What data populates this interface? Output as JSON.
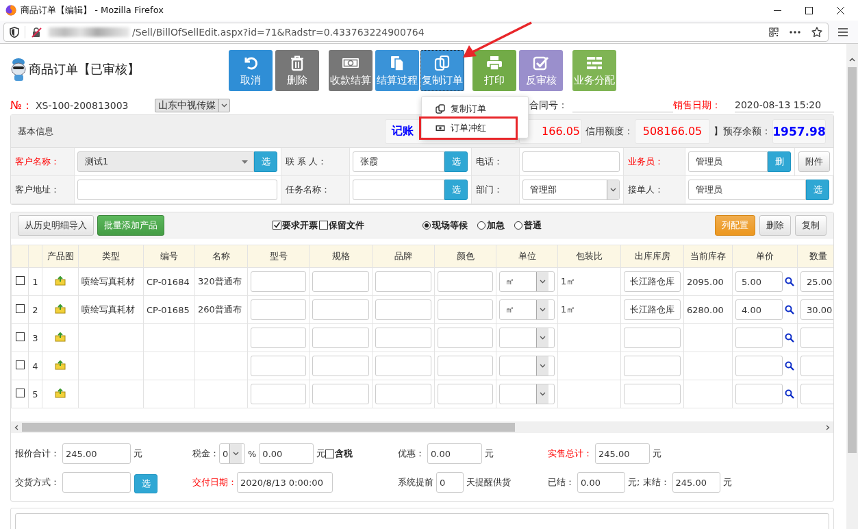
{
  "window": {
    "title": "商品订单【编辑】 - Mozilla Firefox"
  },
  "address_bar": {
    "url": "/Sell/BillOfSellEdit.aspx?id=71&Radstr=0.433763224900764"
  },
  "page": {
    "title": "商品订单【已审核】"
  },
  "toolbar": [
    {
      "label": "取消",
      "kind": "undo",
      "color": "#2f8ed6",
      "focused": false
    },
    {
      "label": "删除",
      "kind": "trash",
      "color": "#777777",
      "focused": false
    },
    {
      "label": "收款结算",
      "kind": "money",
      "color": "#777777",
      "focused": false
    },
    {
      "label": "结算过程",
      "kind": "document",
      "color": "#3a93d8",
      "focused": false
    },
    {
      "label": "复制订单",
      "kind": "copy",
      "color": "#3a93d8",
      "focused": true
    },
    {
      "label": "打印",
      "kind": "print",
      "color": "#72ab47",
      "focused": false
    },
    {
      "label": "反审核",
      "kind": "check",
      "color": "#9a8fcc",
      "focused": false
    },
    {
      "label": "业务分配",
      "kind": "bars",
      "color": "#7fb454",
      "focused": false
    }
  ],
  "order": {
    "no_label": "№：",
    "no": "XS-100-200813003",
    "company": "山东中视传媒",
    "contract_label": "合同号：",
    "date_label": "销售日期：",
    "date": "2020-08-13 15:20"
  },
  "info": {
    "title": "基本信息",
    "stats": [
      {
        "value": "记账",
        "color": "#0000ff"
      },
      {
        "value": "166.05",
        "color": "#ff0000"
      },
      {
        "label": "信用额度：",
        "value": "508166.05",
        "color": "#ff0000"
      },
      {
        "label": "】预存余额：",
        "value": "1957.98",
        "color": "#0000ff"
      }
    ],
    "rows": [
      {
        "cells": [
          {
            "label": "客户名称：",
            "required": true,
            "kind": "combo",
            "value": "测试1",
            "button": "选"
          },
          {
            "label": "联 系 人：",
            "required": false,
            "kind": "input",
            "value": "张霞",
            "button": "选"
          },
          {
            "label": "电话：",
            "required": false,
            "kind": "input"
          },
          {
            "label": "业务员：",
            "required": true,
            "kind": "input",
            "value": "管理员",
            "button": "删"
          }
        ],
        "button": "附件"
      },
      {
        "cells": [
          {
            "label": "客户地址：",
            "required": false,
            "kind": "input"
          },
          {
            "label": "任务名称：",
            "required": false,
            "kind": "input",
            "button": "选"
          },
          {
            "label": "部门：",
            "required": false,
            "kind": "select",
            "value": "管理部"
          },
          {
            "label": "接单人：",
            "required": false,
            "kind": "input",
            "value": "管理员",
            "button": "选"
          }
        ]
      }
    ]
  },
  "products": {
    "left_buttons": [
      {
        "label": "从历史明细导入",
        "kind": "default"
      },
      {
        "label": "批量添加产品",
        "kind": "success"
      }
    ],
    "checkboxes": [
      {
        "label": "要求开票",
        "checked": true
      },
      {
        "label": "保留文件",
        "checked": false
      }
    ],
    "radios": [
      {
        "label": "现场等候",
        "selected": true
      },
      {
        "label": "加急",
        "selected": false
      },
      {
        "label": "普通",
        "selected": false
      }
    ],
    "right_buttons": [
      {
        "label": "列配置",
        "kind": "warning"
      },
      {
        "label": "删除",
        "kind": "default"
      },
      {
        "label": "复制",
        "kind": "default"
      }
    ],
    "columns": [
      "产品图",
      "类型",
      "编号",
      "名称",
      "型号",
      "规格",
      "品牌",
      "颜色",
      "单位",
      "包装比",
      "出库库房",
      "当前库存",
      "单价",
      "数量"
    ],
    "rows": [
      {
        "checked": false,
        "no": "1",
        "type": "喷绘写真耗材",
        "code": "CP-01684",
        "name": "320普通布",
        "unit": "㎡",
        "pack": "1㎡",
        "warehouse": "长江路仓库",
        "stock": "2095.00",
        "price": "5.00",
        "qty": "25.00"
      },
      {
        "checked": false,
        "no": "2",
        "type": "喷绘写真耗材",
        "code": "CP-01685",
        "name": "260普通布",
        "unit": "㎡",
        "pack": "1㎡",
        "warehouse": "长江路仓库",
        "stock": "6280.00",
        "price": "4.00",
        "qty": "30.00"
      },
      {
        "checked": false,
        "no": "3"
      },
      {
        "checked": false,
        "no": "4"
      },
      {
        "checked": false,
        "no": "5"
      }
    ]
  },
  "totals": [
    [
      [
        {
          "kind": "label",
          "text": "报价合计：",
          "required": false
        },
        {
          "kind": "input",
          "value": "245.00"
        },
        {
          "kind": "text",
          "text": "元"
        }
      ],
      [
        {
          "kind": "label",
          "text": "税金：",
          "required": false
        },
        {
          "kind": "select",
          "value": "0"
        },
        {
          "kind": "text",
          "text": "%"
        },
        {
          "kind": "input",
          "value": "0.00"
        },
        {
          "kind": "text",
          "text": "元"
        },
        {
          "kind": "checkbox",
          "label": "含税",
          "checked": false
        }
      ],
      [
        {
          "kind": "label",
          "text": "优惠：",
          "required": false
        },
        {
          "kind": "input",
          "value": "0.00"
        },
        {
          "kind": "text",
          "text": "元"
        }
      ],
      [
        {
          "kind": "label",
          "text": "实售总计：",
          "required": true
        },
        {
          "kind": "input",
          "value": "245.00"
        },
        {
          "kind": "text",
          "text": "元"
        }
      ]
    ],
    [
      [
        {
          "kind": "label",
          "text": "交货方式：",
          "required": false
        },
        {
          "kind": "input"
        },
        {
          "kind": "button",
          "text": "选"
        }
      ],
      [
        {
          "kind": "label",
          "text": "交付日期：",
          "required": true
        },
        {
          "kind": "date_input",
          "value": "2020/8/13 0:00:00"
        }
      ],
      [
        {
          "kind": "text",
          "text": "系统提前"
        },
        {
          "kind": "short_input",
          "value": "0"
        },
        {
          "kind": "text",
          "text": "天提醒供货"
        }
      ],
      [
        {
          "kind": "label",
          "text": "已结：",
          "required": false
        },
        {
          "kind": "input",
          "value": "0.00"
        },
        {
          "kind": "text",
          "text": "元; 末结："
        },
        {
          "kind": "input",
          "value": "245.00"
        },
        {
          "kind": "text",
          "text": "元"
        }
      ]
    ]
  ],
  "menu": {
    "items": [
      {
        "label": "复制订单",
        "kind": "copy",
        "annotated": false
      },
      {
        "label": "订单冲红",
        "kind": "money",
        "annotated": true
      }
    ]
  }
}
